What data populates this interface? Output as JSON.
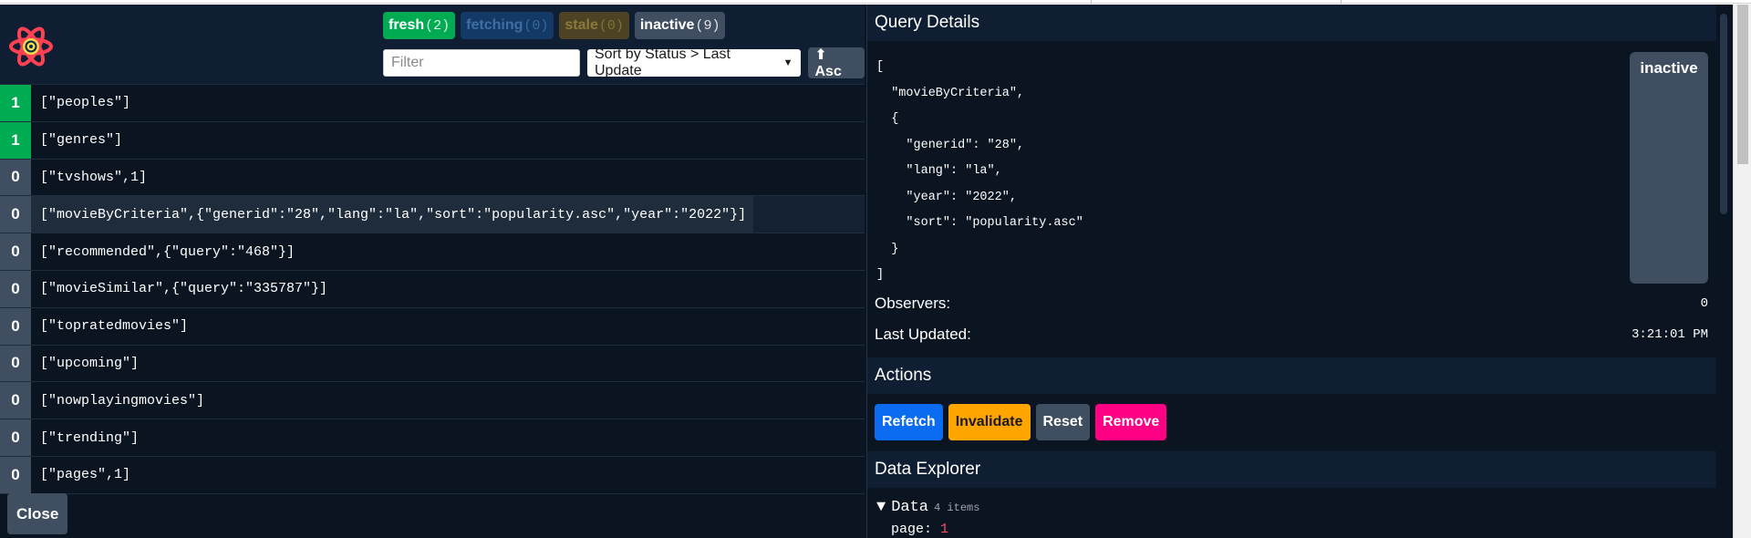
{
  "status_badges": [
    {
      "label": "fresh",
      "count": "(2)"
    },
    {
      "label": "fetching",
      "count": "(0)"
    },
    {
      "label": "stale",
      "count": "(0)"
    },
    {
      "label": "inactive",
      "count": "(9)"
    }
  ],
  "filter": {
    "placeholder": "Filter",
    "value": ""
  },
  "sort": {
    "label": "Sort by Status > Last Update"
  },
  "asc_button": "⬆ Asc",
  "queries": [
    {
      "observers": "1",
      "key": "[\"peoples\"]",
      "status": "fresh"
    },
    {
      "observers": "1",
      "key": "[\"genres\"]",
      "status": "fresh"
    },
    {
      "observers": "0",
      "key": "[\"tvshows\",1]",
      "status": "inactive"
    },
    {
      "observers": "0",
      "key": "[\"movieByCriteria\",{\"generid\":\"28\",\"lang\":\"la\",\"sort\":\"popularity.asc\",\"year\":\"2022\"}]",
      "status": "inactive",
      "selected": true
    },
    {
      "observers": "0",
      "key": "[\"recommended\",{\"query\":\"468\"}]",
      "status": "inactive"
    },
    {
      "observers": "0",
      "key": "[\"movieSimilar\",{\"query\":\"335787\"}]",
      "status": "inactive"
    },
    {
      "observers": "0",
      "key": "[\"topratedmovies\"]",
      "status": "inactive"
    },
    {
      "observers": "0",
      "key": "[\"upcoming\"]",
      "status": "inactive"
    },
    {
      "observers": "0",
      "key": "[\"nowplayingmovies\"]",
      "status": "inactive"
    },
    {
      "observers": "0",
      "key": "[\"trending\"]",
      "status": "inactive"
    },
    {
      "observers": "0",
      "key": "[\"pages\",1]",
      "status": "inactive"
    }
  ],
  "close_button": "Close",
  "details": {
    "title": "Query Details",
    "query_key_pretty": "[\n  \"movieByCriteria\",\n  {\n    \"generid\": \"28\",\n    \"lang\": \"la\",\n    \"year\": \"2022\",\n    \"sort\": \"popularity.asc\"\n  }\n]",
    "status": "inactive",
    "observers_label": "Observers:",
    "observers_value": "0",
    "last_updated_label": "Last Updated:",
    "last_updated_value": "3:21:01 PM"
  },
  "actions": {
    "title": "Actions",
    "refetch": "Refetch",
    "invalidate": "Invalidate",
    "reset": "Reset",
    "remove": "Remove"
  },
  "explorer": {
    "title": "Data Explorer",
    "root_label": "Data",
    "root_count": "4 items",
    "first_key": "page:",
    "first_value": "1"
  },
  "colors": {
    "fresh": "#00ab52",
    "inactive": "#3f4e60",
    "refetch": "#0b6cf2",
    "invalidate": "#ffa500",
    "remove": "#ff0085",
    "panel_bg": "#0b1521"
  },
  "icons": {
    "logo": "react-query-logo-icon",
    "disclosure": "triangle-down-icon"
  }
}
